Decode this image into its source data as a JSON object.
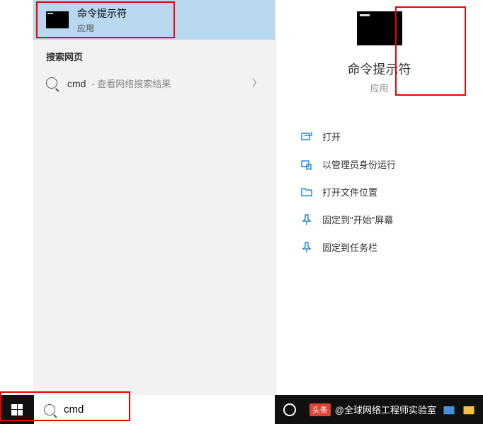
{
  "bestMatch": {
    "title": "命令提示符",
    "subtitle": "应用"
  },
  "webSection": {
    "header": "搜索网页",
    "query": "cmd",
    "hint": "查看网络搜索结果",
    "chevron": "〉"
  },
  "detail": {
    "title": "命令提示符",
    "subtitle": "应用"
  },
  "actions": [
    {
      "icon": "open",
      "label": "打开"
    },
    {
      "icon": "admin",
      "label": "以管理员身份运行"
    },
    {
      "icon": "location",
      "label": "打开文件位置"
    },
    {
      "icon": "pin-start",
      "label": "固定到\"开始\"屏幕"
    },
    {
      "icon": "pin-taskbar",
      "label": "固定到任务栏"
    }
  ],
  "taskbar": {
    "searchValue": "cmd",
    "toutiao": {
      "badge": "头条",
      "author": "@全球网络工程师实验室"
    }
  }
}
